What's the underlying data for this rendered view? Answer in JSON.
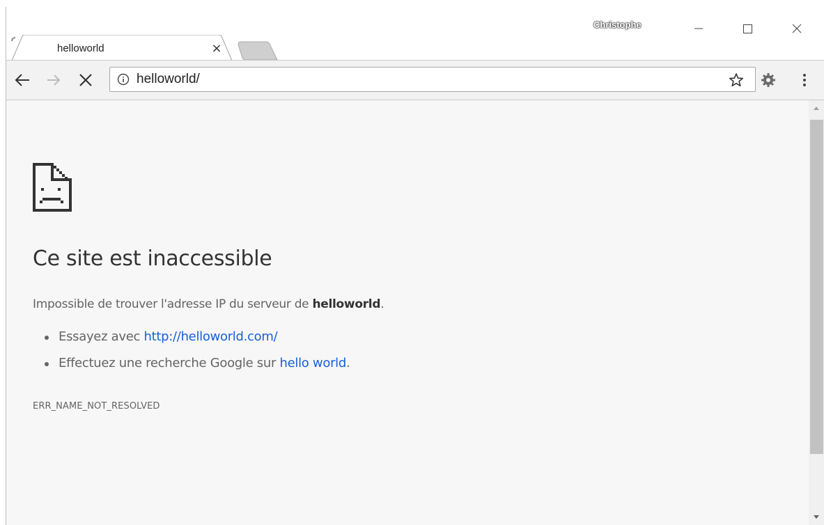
{
  "window": {
    "profile_name": "Christophe"
  },
  "tabs": [
    {
      "title": "helloworld",
      "loading": true,
      "close_glyph": "×"
    }
  ],
  "toolbar": {
    "url": "helloworld/",
    "icons": [
      "back-arrow-icon",
      "forward-arrow-icon",
      "stop-icon",
      "info-icon",
      "star-icon",
      "extension-icon",
      "menu-icon"
    ]
  },
  "error_page": {
    "heading": "Ce site est inaccessible",
    "message_prefix": "Impossible de trouver l'adresse IP du serveur de ",
    "message_host": "helloworld",
    "message_suffix": ".",
    "suggestions": [
      {
        "prefix": "Essayez avec ",
        "link": "http://helloworld.com/",
        "suffix": ""
      },
      {
        "prefix": "Effectuez une recherche Google sur ",
        "link": "hello world",
        "suffix": "."
      }
    ],
    "error_code": "ERR_NAME_NOT_RESOLVED"
  },
  "colors": {
    "link": "#1a5ed6",
    "page_bg": "#f7f7f7",
    "toolbar_bg": "#f2f2f2",
    "text": "#646464",
    "heading": "#333333"
  }
}
